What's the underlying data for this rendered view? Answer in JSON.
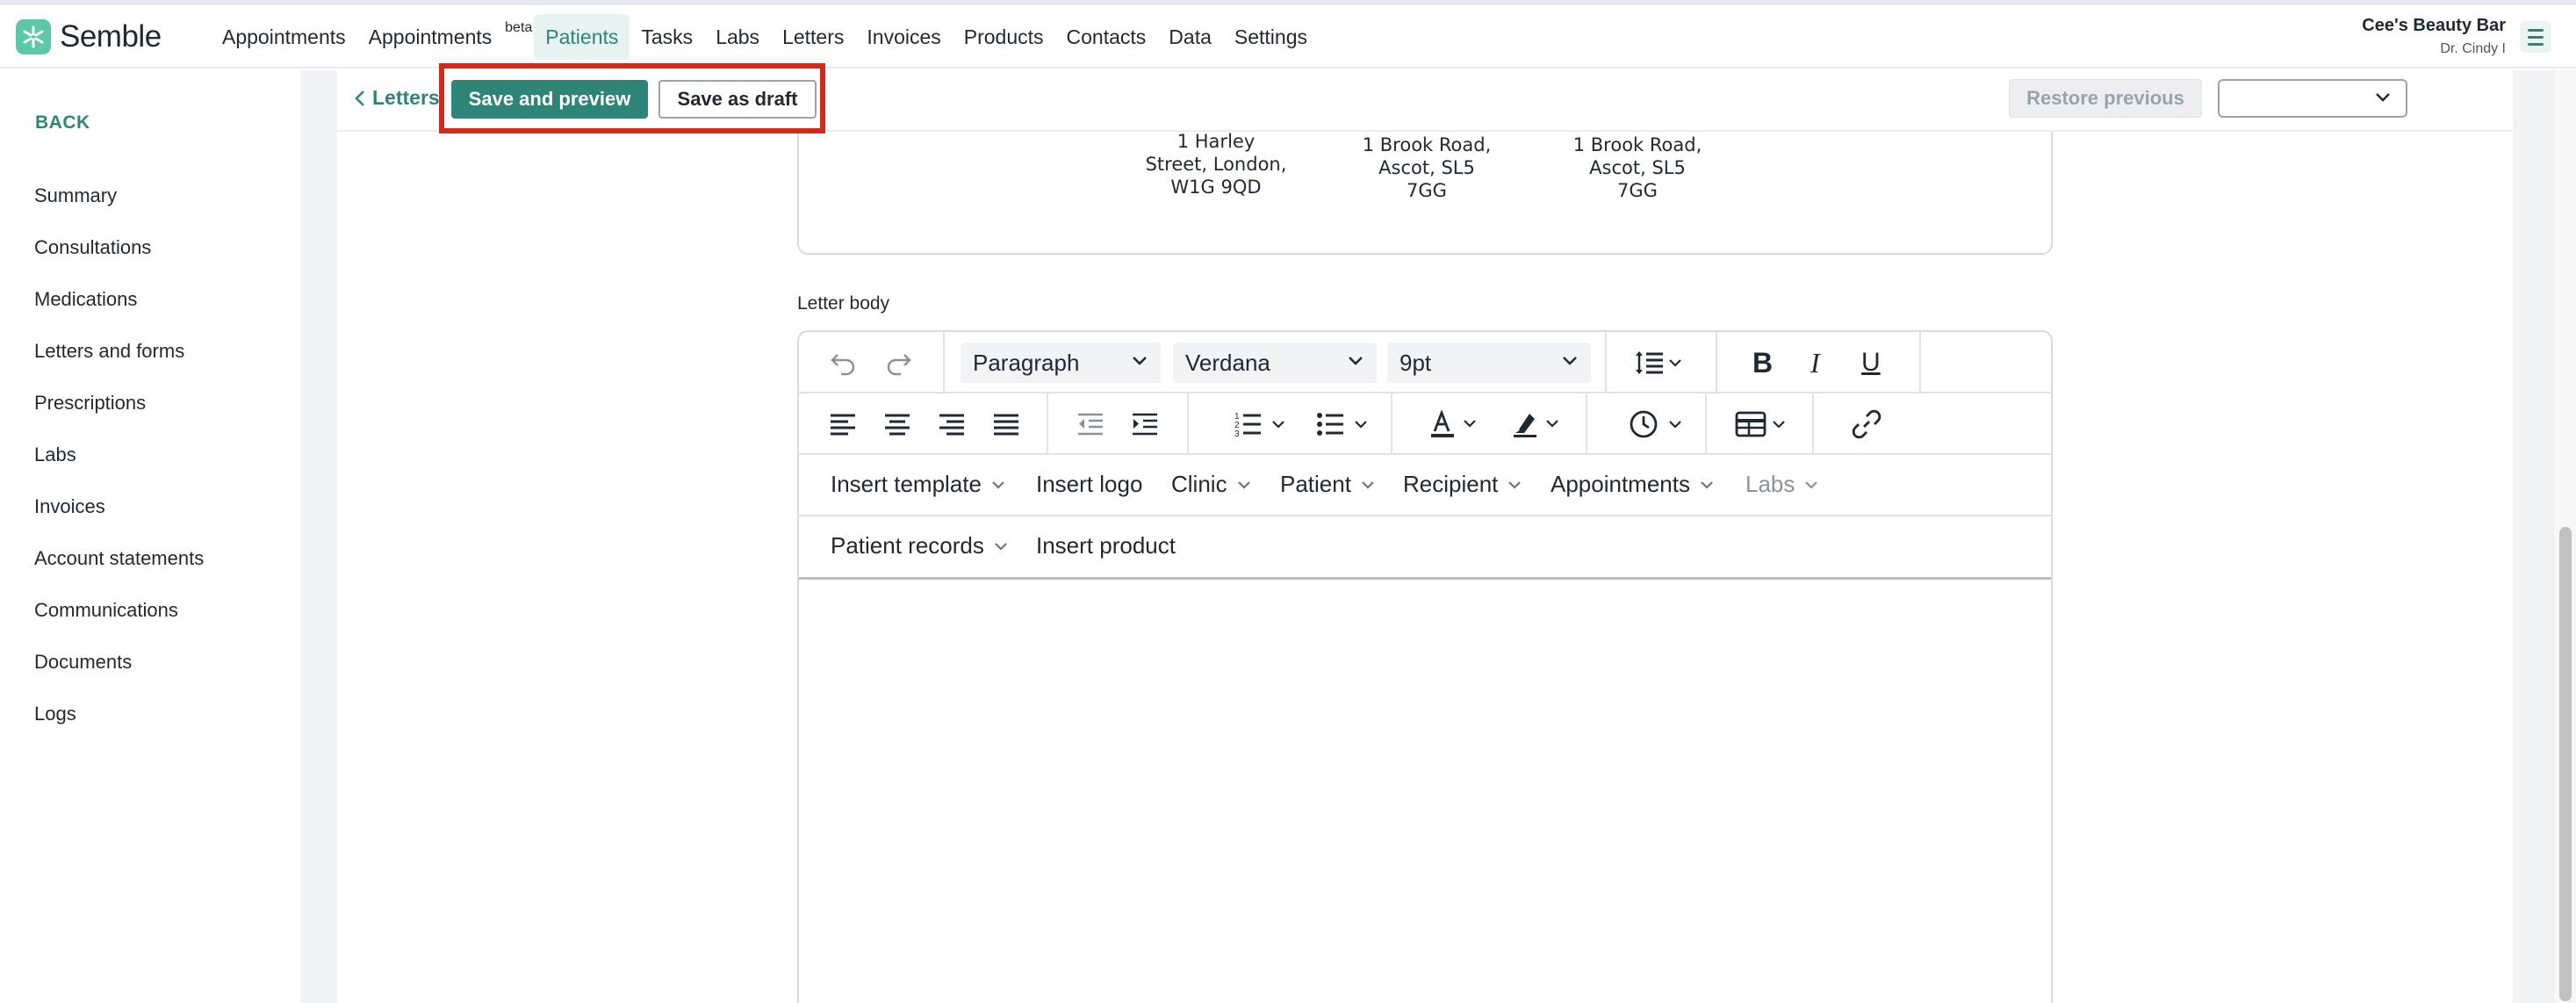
{
  "app": {
    "brand": "Semble",
    "colors": {
      "accent": "#2e8577",
      "logo": "#5cc8a7",
      "highlight": "#d12b1e"
    }
  },
  "nav": {
    "items": [
      {
        "label": "Appointments"
      },
      {
        "label": "Appointments",
        "badge": "beta"
      },
      {
        "label": "Patients",
        "active": true
      },
      {
        "label": "Tasks"
      },
      {
        "label": "Labs"
      },
      {
        "label": "Letters"
      },
      {
        "label": "Invoices"
      },
      {
        "label": "Products"
      },
      {
        "label": "Contacts"
      },
      {
        "label": "Data"
      },
      {
        "label": "Settings"
      }
    ]
  },
  "account": {
    "name": "Cee's Beauty Bar",
    "user": "Dr. Cindy I"
  },
  "sidebar": {
    "back_label": "BACK",
    "items": [
      {
        "label": "Summary"
      },
      {
        "label": "Consultations"
      },
      {
        "label": "Medications"
      },
      {
        "label": "Letters and forms"
      },
      {
        "label": "Prescriptions"
      },
      {
        "label": "Labs"
      },
      {
        "label": "Invoices"
      },
      {
        "label": "Account statements"
      },
      {
        "label": "Communications"
      },
      {
        "label": "Documents"
      },
      {
        "label": "Logs"
      }
    ]
  },
  "toolbar": {
    "back_link": "Letters",
    "save_preview_label": "Save and preview",
    "save_draft_label": "Save as draft",
    "restore_label": "Restore previous",
    "version_select_value": ""
  },
  "addresses": [
    "1 Harley\nStreet, London,\nW1G 9QD",
    "1 Brook Road,\nAscot, SL5\n7GG",
    "1 Brook Road,\nAscot, SL5\n7GG"
  ],
  "letter_body": {
    "label": "Letter body",
    "block_format": "Paragraph",
    "font_family": "Verdana",
    "font_size": "9pt",
    "insert_menus": {
      "row1": [
        {
          "label": "Insert template",
          "dropdown": true
        },
        {
          "label": "Insert logo",
          "dropdown": false
        },
        {
          "label": "Clinic",
          "dropdown": true
        },
        {
          "label": "Patient",
          "dropdown": true
        },
        {
          "label": "Recipient",
          "dropdown": true
        },
        {
          "label": "Appointments",
          "dropdown": true
        },
        {
          "label": "Labs",
          "dropdown": true,
          "disabled": true
        }
      ],
      "row2": [
        {
          "label": "Patient records",
          "dropdown": true
        },
        {
          "label": "Insert product",
          "dropdown": false
        }
      ]
    }
  }
}
